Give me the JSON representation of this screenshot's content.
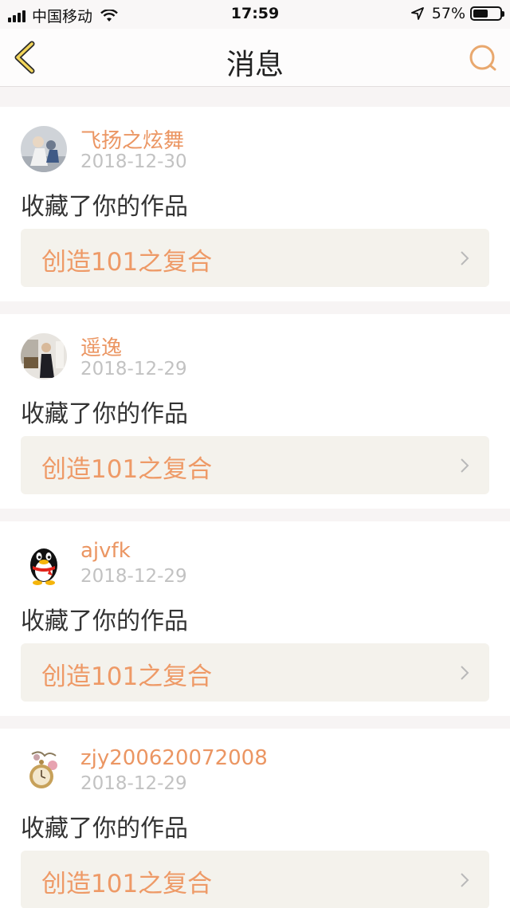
{
  "status_bar": {
    "carrier": "中国移动",
    "time": "17:59",
    "battery_percent": "57%",
    "battery_level": 0.57,
    "icons": [
      "signal-icon",
      "wifi-icon",
      "location-icon",
      "battery-icon"
    ]
  },
  "nav": {
    "title": "消息",
    "back_icon": "chevron-left-icon",
    "search_icon": "search-icon",
    "accent_color": "#e9a86e"
  },
  "messages": [
    {
      "username": "飞扬之炫舞",
      "date": "2018-12-30",
      "action": "收藏了你的作品",
      "work_title": "创造101之复合"
    },
    {
      "username": "遥逸",
      "date": "2018-12-29",
      "action": "收藏了你的作品",
      "work_title": "创造101之复合"
    },
    {
      "username": "ajvfk",
      "date": "2018-12-29",
      "action": "收藏了你的作品",
      "work_title": "创造101之复合"
    },
    {
      "username": "zjy200620072008",
      "date": "2018-12-29",
      "action": "收藏了你的作品",
      "work_title": "创造101之复合"
    }
  ],
  "colors": {
    "username": "#eb9663",
    "date": "#c2c2c2",
    "work_title": "#ee9a67",
    "work_bg": "#f4f2ec"
  }
}
